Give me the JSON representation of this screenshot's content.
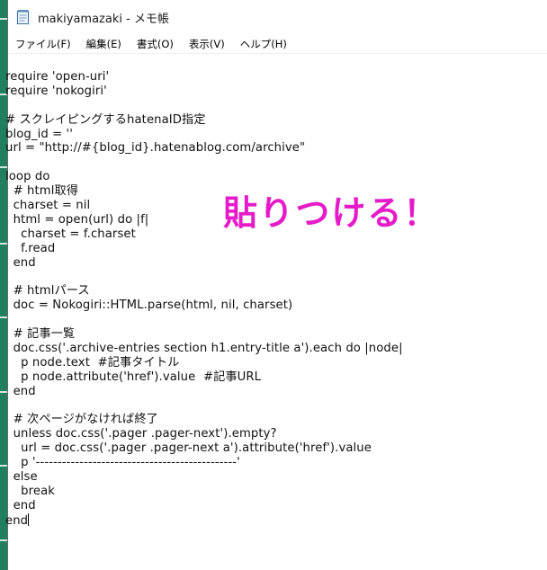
{
  "window": {
    "title": "makiyamazaki - メモ帳"
  },
  "menubar": {
    "items": [
      {
        "label": "ファイル(F)"
      },
      {
        "label": "編集(E)"
      },
      {
        "label": "書式(O)"
      },
      {
        "label": "表示(V)"
      },
      {
        "label": "ヘルプ(H)"
      }
    ]
  },
  "editor": {
    "lines": [
      "require 'open-uri'",
      "require 'nokogiri'",
      "",
      "# スクレイピングするhatenaID指定",
      "blog_id = ''",
      "url = \"http://#{blog_id}.hatenablog.com/archive\"",
      "",
      "loop do",
      "  # html取得",
      "  charset = nil",
      "  html = open(url) do |f|",
      "    charset = f.charset",
      "    f.read",
      "  end",
      "",
      "  # htmlパース",
      "  doc = Nokogiri::HTML.parse(html, nil, charset)",
      "",
      "  # 記事一覧",
      "  doc.css('.archive-entries section h1.entry-title a').each do |node|",
      "    p node.text  #記事タイトル",
      "    p node.attribute('href').value  #記事URL",
      "  end",
      "",
      "  # 次ページがなければ終了",
      "  unless doc.css('.pager .pager-next').empty?",
      "    url = doc.css('.pager .pager-next a').attribute('href').value",
      "    p '----------------------------------------------'",
      "  else",
      "    break",
      "  end",
      "end"
    ]
  },
  "overlay": {
    "text": "貼りつける！",
    "color": "#e61ac9"
  },
  "icons": {
    "app": "notepad-icon"
  }
}
